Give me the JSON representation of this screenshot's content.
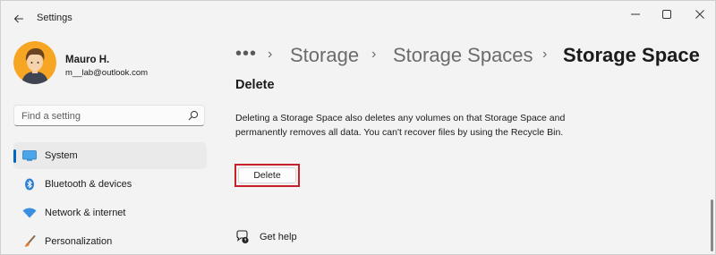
{
  "window": {
    "title": "Settings"
  },
  "profile": {
    "name": "Mauro H.",
    "email": "m__lab@outlook.com"
  },
  "search": {
    "placeholder": "Find a setting"
  },
  "sidebar": {
    "items": [
      {
        "label": "System",
        "icon": "monitor-icon",
        "active": true
      },
      {
        "label": "Bluetooth & devices",
        "icon": "bluetooth-icon",
        "active": false
      },
      {
        "label": "Network & internet",
        "icon": "wifi-icon",
        "active": false
      },
      {
        "label": "Personalization",
        "icon": "brush-icon",
        "active": false
      }
    ]
  },
  "breadcrumb": {
    "more": "•••",
    "items": [
      "Storage",
      "Storage Spaces",
      "Storage Space"
    ]
  },
  "content": {
    "section_title": "Delete",
    "description": "Deleting a Storage Space also deletes any volumes on that Storage Space and permanently removes all data. You can't recover files by using the Recycle Bin.",
    "delete_label": "Delete",
    "help_label": "Get help"
  },
  "colors": {
    "accent": "#0067c0",
    "highlight": "#c8202a",
    "background": "#f3f3f3"
  }
}
